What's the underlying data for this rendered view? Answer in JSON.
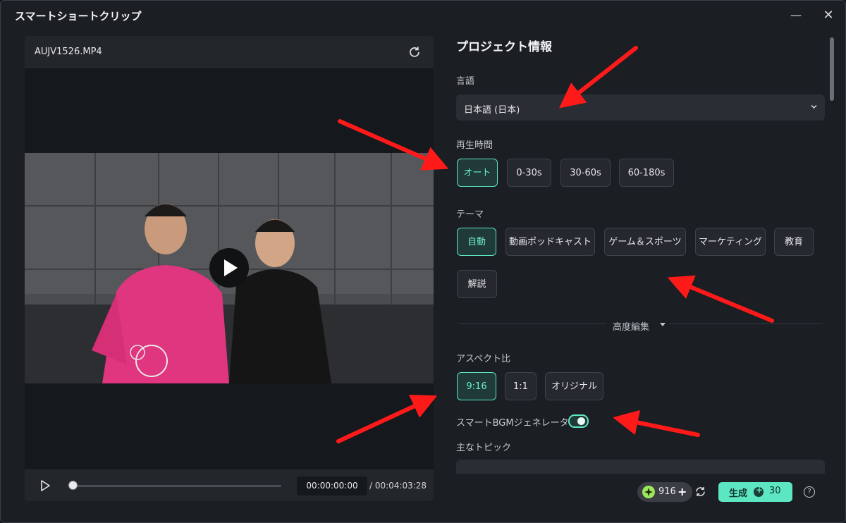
{
  "window": {
    "title": "スマートショートクリップ"
  },
  "preview": {
    "filename": "AUJV1526.MP4",
    "time_current": "00:00:00:00",
    "time_total": "/ 00:04:03:28",
    "progress": 0
  },
  "project": {
    "title": "プロジェクト情報",
    "language_label": "言語",
    "language_value": "日本語 (日本)",
    "duration_label": "再生時間",
    "durations": [
      "オート",
      "0-30s",
      "30-60s",
      "60-180s"
    ],
    "theme_label": "テーマ",
    "themes": [
      "自動",
      "動画ポッドキャスト",
      "ゲーム＆スポーツ",
      "マーケティング",
      "教育",
      "解説"
    ],
    "advanced_label": "高度編集",
    "aspect_label": "アスペクト比",
    "aspects": [
      "9:16",
      "1:1",
      "オリジナル"
    ],
    "bgm_label": "スマートBGMジェネレーター",
    "bgm_enabled": true,
    "topic_label": "主なトピック"
  },
  "footer": {
    "credits": "916",
    "generate_label": "生成",
    "generate_cost": "30"
  },
  "colors": {
    "accent": "#5ce6c2",
    "annotation": "#ff1a1a"
  }
}
